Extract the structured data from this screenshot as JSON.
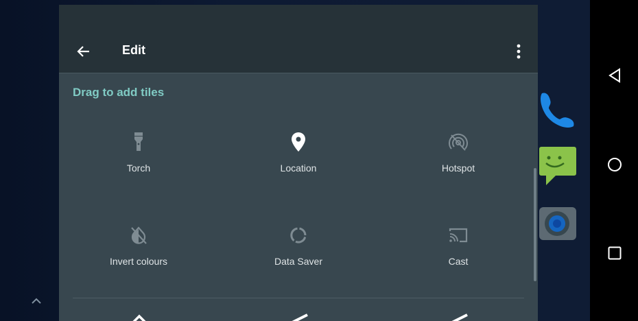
{
  "toolbar": {
    "title": "Edit"
  },
  "section": {
    "header": "Drag to add tiles"
  },
  "tiles": [
    {
      "label": "Torch",
      "icon": "torch-icon"
    },
    {
      "label": "Location",
      "icon": "location-pin-icon"
    },
    {
      "label": "Hotspot",
      "icon": "hotspot-icon"
    },
    {
      "label": "Invert colours",
      "icon": "invert-colours-icon"
    },
    {
      "label": "Data Saver",
      "icon": "data-saver-icon"
    },
    {
      "label": "Cast",
      "icon": "cast-icon"
    }
  ],
  "navigation": {
    "buttons": [
      "back-icon",
      "home-icon",
      "recents-icon"
    ]
  },
  "colors": {
    "panel_background": "#38474f",
    "toolbar_background": "#263238",
    "accent": "#80cbc4",
    "navbar": "#000000"
  }
}
